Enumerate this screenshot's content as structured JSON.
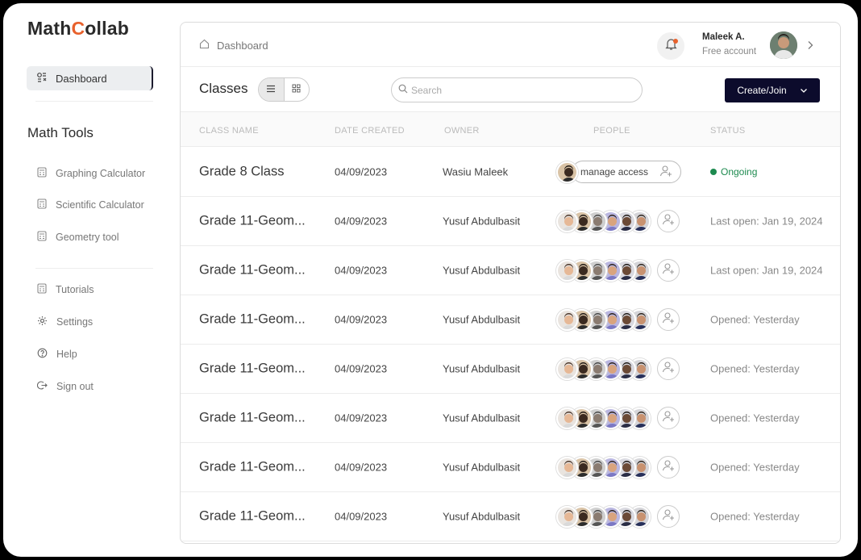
{
  "app": {
    "logo_part1": "Math",
    "logo_accent": "C",
    "logo_part2": "ollab"
  },
  "sidebar": {
    "active_item": {
      "label": "Dashboard",
      "icon": "dashboard-icon"
    },
    "section_title": "Math Tools",
    "tools": [
      {
        "label": "Graphing Calculator",
        "icon": "calculator-icon"
      },
      {
        "label": "Scientific Calculator",
        "icon": "calculator-icon"
      },
      {
        "label": "Geometry tool",
        "icon": "calculator-icon"
      }
    ],
    "items": [
      {
        "label": "Tutorials",
        "icon": "calculator-icon"
      },
      {
        "label": "Settings",
        "icon": "gear-icon"
      },
      {
        "label": "Help",
        "icon": "help-icon"
      },
      {
        "label": "Sign out",
        "icon": "sign-out-icon"
      }
    ]
  },
  "header": {
    "breadcrumb": "Dashboard",
    "user": {
      "name": "Maleek A.",
      "plan": "Free account"
    }
  },
  "classes": {
    "title": "Classes",
    "search_placeholder": "Search",
    "create_label": "Create/Join",
    "columns": [
      "CLASS NAME",
      "DATE CREATED",
      "OWNER",
      "PEOPLE",
      "STATUS"
    ],
    "rows": [
      {
        "name": "Grade 8 Class",
        "date": "04/09/2023",
        "owner": "Wasiu Maleek",
        "status": "Ongoing",
        "manage": "manage access"
      },
      {
        "name": "Grade 11-Geom...",
        "date": "04/09/2023",
        "owner": "Yusuf Abdulbasit",
        "status": "Last open: Jan 19, 2024"
      },
      {
        "name": "Grade 11-Geom...",
        "date": "04/09/2023",
        "owner": "Yusuf Abdulbasit",
        "status": "Last open: Jan 19, 2024"
      },
      {
        "name": "Grade 11-Geom...",
        "date": "04/09/2023",
        "owner": "Yusuf Abdulbasit",
        "status": "Opened: Yesterday"
      },
      {
        "name": "Grade 11-Geom...",
        "date": "04/09/2023",
        "owner": "Yusuf Abdulbasit",
        "status": "Opened: Yesterday"
      },
      {
        "name": "Grade 11-Geom...",
        "date": "04/09/2023",
        "owner": "Yusuf Abdulbasit",
        "status": "Opened: Yesterday"
      },
      {
        "name": "Grade 11-Geom...",
        "date": "04/09/2023",
        "owner": "Yusuf Abdulbasit",
        "status": "Opened: Yesterday"
      },
      {
        "name": "Grade 11-Geom...",
        "date": "04/09/2023",
        "owner": "Yusuf Abdulbasit",
        "status": "Opened: Yesterday"
      }
    ]
  },
  "colors": {
    "brand_accent": "#e8612c",
    "primary_button": "#0c0b2c",
    "status_ongoing": "#1d8a4f"
  }
}
